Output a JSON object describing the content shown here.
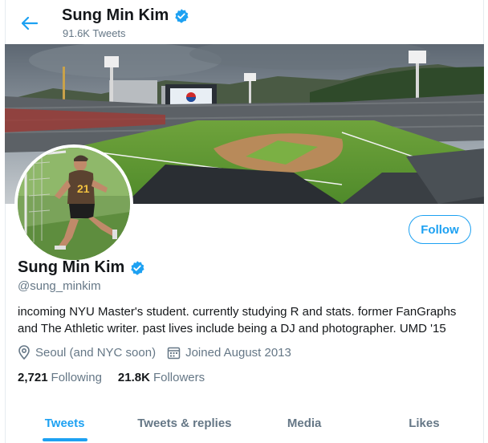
{
  "header": {
    "name": "Sung Min Kim",
    "tweet_count": "91.6K Tweets"
  },
  "profile": {
    "name": "Sung Min Kim",
    "handle": "@sung_minkim",
    "bio": "incoming NYU Master's student. currently studying R and stats. former FanGraphs and The Athletic writer. past lives include being a DJ and photographer. UMD '15",
    "location": "Seoul (and NYC soon)",
    "joined": "Joined August 2013",
    "following_count": "2,721",
    "following_label": "Following",
    "followers_count": "21.8K",
    "followers_label": "Followers",
    "follow_label": "Follow",
    "avatar_jersey_number": "21"
  },
  "tabs": [
    {
      "label": "Tweets",
      "active": true
    },
    {
      "label": "Tweets & replies",
      "active": false
    },
    {
      "label": "Media",
      "active": false
    },
    {
      "label": "Likes",
      "active": false
    }
  ],
  "colors": {
    "accent": "#1da1f2",
    "muted": "#657786",
    "text": "#14171a"
  }
}
